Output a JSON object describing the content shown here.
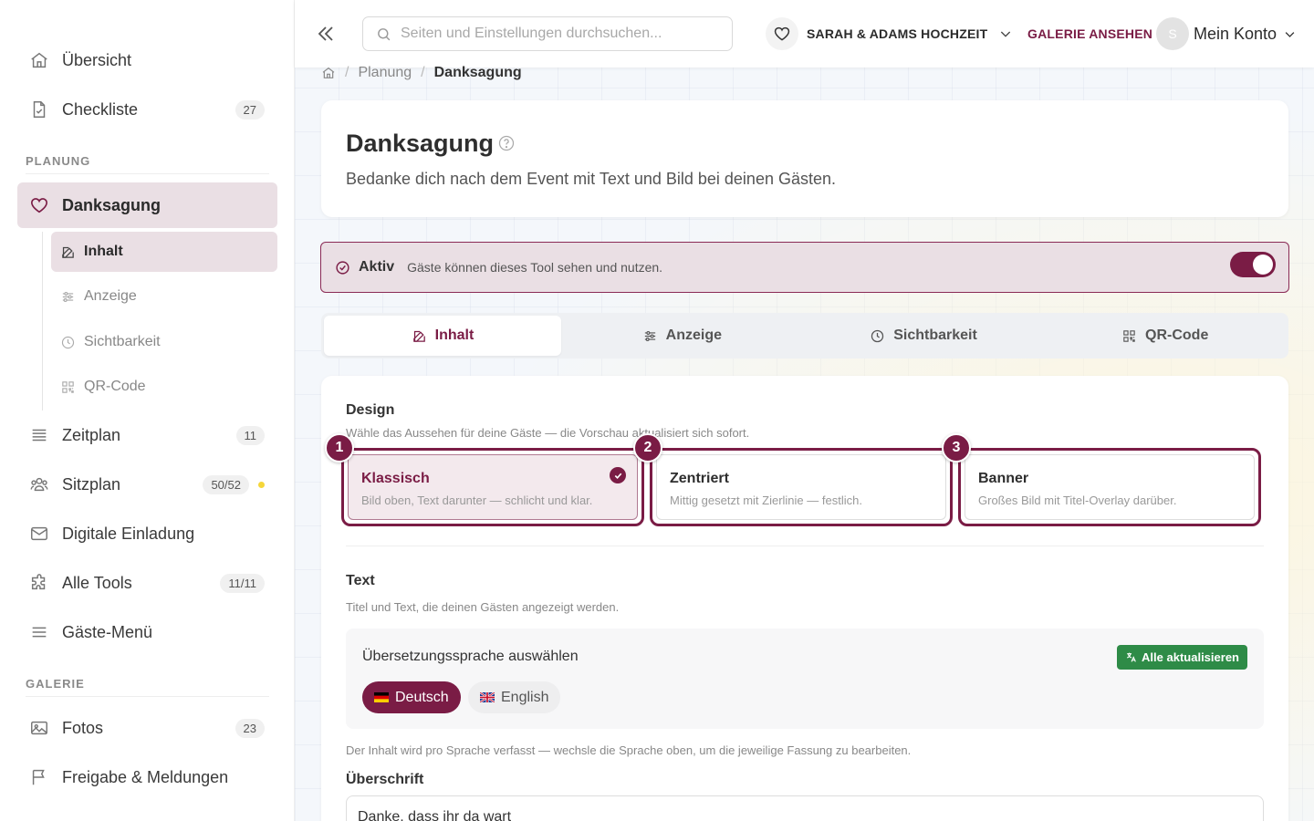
{
  "sidebar": {
    "items": [
      {
        "label": "Übersicht"
      },
      {
        "label": "Checkliste",
        "badge": "27"
      },
      {
        "label": "Danksagung"
      },
      {
        "label": "Zeitplan",
        "badge": "11"
      },
      {
        "label": "Sitzplan",
        "badge": "50/52"
      },
      {
        "label": "Digitale Einladung"
      },
      {
        "label": "Alle Tools",
        "badge": "11/11"
      },
      {
        "label": "Gäste-Menü"
      },
      {
        "label": "Fotos",
        "badge": "23"
      },
      {
        "label": "Freigabe & Meldungen"
      }
    ],
    "sections": {
      "planning": "PLANUNG",
      "gallery": "GALERIE"
    },
    "sub_items": [
      {
        "label": "Inhalt"
      },
      {
        "label": "Anzeige"
      },
      {
        "label": "Sichtbarkeit"
      },
      {
        "label": "QR-Code"
      }
    ]
  },
  "topbar": {
    "search_placeholder": "Seiten und Einstellungen durchsuchen...",
    "event_name": "SARAH & ADAMS HOCHZEIT",
    "gallery_link": "GALERIE ANSEHEN",
    "avatar_initial": "S",
    "account_label": "Mein Konto"
  },
  "breadcrumb": {
    "parent": "Planung",
    "current": "Danksagung"
  },
  "header": {
    "title": "Danksagung",
    "description": "Bedanke dich nach dem Event mit Text und Bild bei deinen Gästen."
  },
  "status": {
    "state": "Aktiv",
    "description": "Gäste können dieses Tool sehen und nutzen.",
    "enabled": true
  },
  "tabs": [
    {
      "label": "Inhalt"
    },
    {
      "label": "Anzeige"
    },
    {
      "label": "Sichtbarkeit"
    },
    {
      "label": "QR-Code"
    }
  ],
  "design": {
    "title": "Design",
    "subtitle": "Wähle das Aussehen für deine Gäste — die Vorschau aktualisiert sich sofort.",
    "options": [
      {
        "number": "1",
        "name": "Klassisch",
        "desc": "Bild oben, Text darunter — schlicht und klar.",
        "selected": true
      },
      {
        "number": "2",
        "name": "Zentriert",
        "desc": "Mittig gesetzt mit Zierlinie — festlich.",
        "selected": false
      },
      {
        "number": "3",
        "name": "Banner",
        "desc": "Großes Bild mit Titel-Overlay darüber.",
        "selected": false
      }
    ]
  },
  "text_section": {
    "title": "Text",
    "subtitle": "Titel und Text, die deinen Gästen angezeigt werden.",
    "lang_title": "Übersetzungssprache auswählen",
    "update_all": "Alle aktualisieren",
    "languages": [
      {
        "label": "Deutsch",
        "active": true
      },
      {
        "label": "English",
        "active": false
      }
    ],
    "note": "Der Inhalt wird pro Sprache verfasst — wechsle die Sprache oben, um die jeweilige Fassung zu bearbeiten.",
    "headline_label": "Überschrift",
    "headline_value": "Danke, dass ihr da wart"
  },
  "colors": {
    "accent": "#7a1c45",
    "accent_light": "#eadfe4",
    "success": "#2e8b47"
  }
}
